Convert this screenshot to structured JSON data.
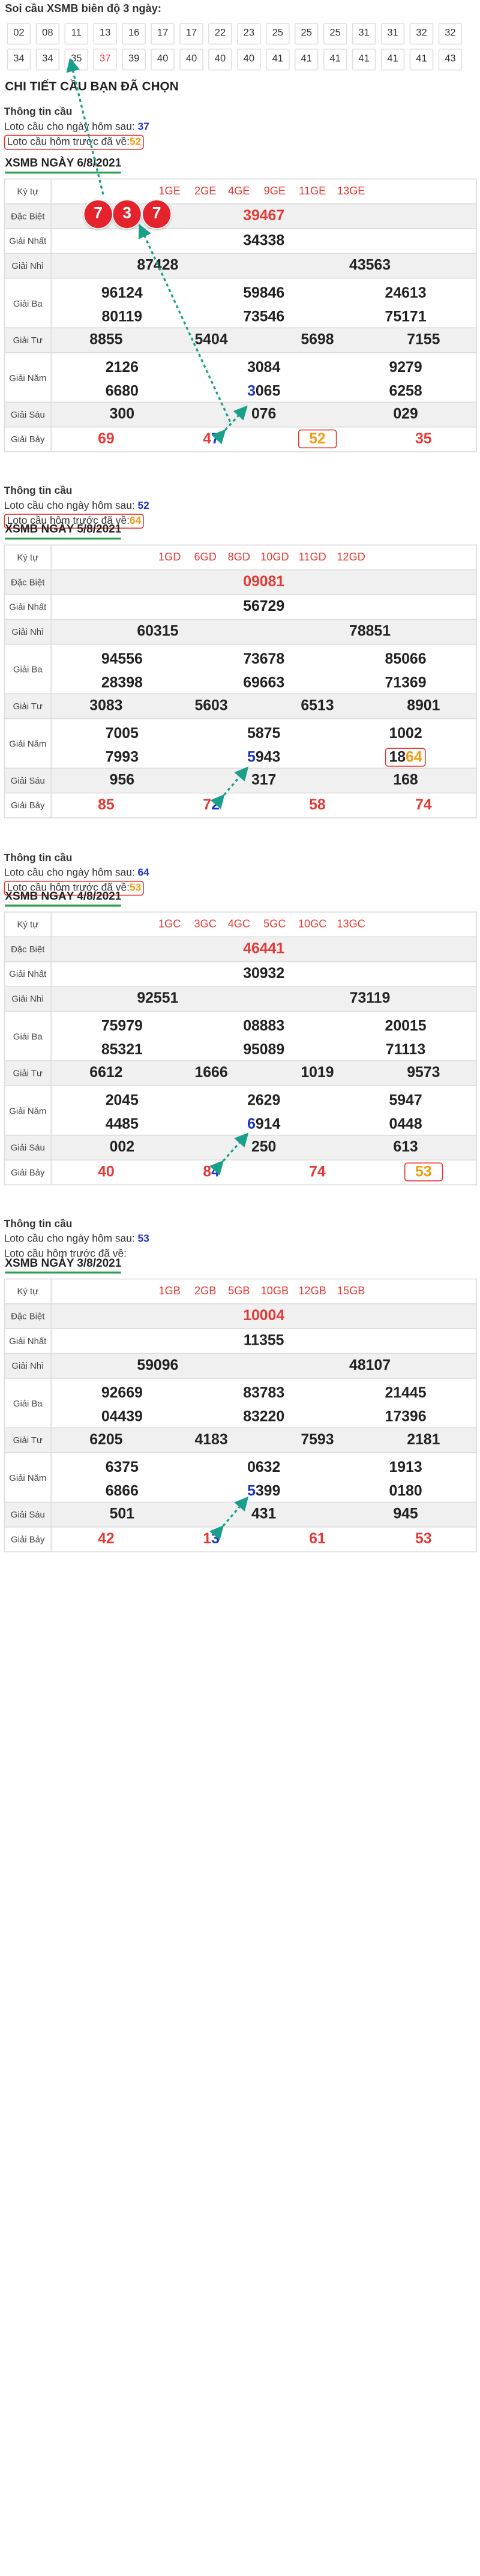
{
  "header": {
    "title": "Soi cầu XSMB biên độ 3 ngày:"
  },
  "chips": [
    "02",
    "08",
    "11",
    "13",
    "16",
    "17",
    "17",
    "22",
    "23",
    "25",
    "25",
    "25",
    "31",
    "31",
    "32",
    "32",
    "34",
    "34",
    "35",
    "37",
    "39",
    "40",
    "40",
    "40",
    "40",
    "41",
    "41",
    "41",
    "41",
    "41",
    "41",
    "43"
  ],
  "section_title": "CHI TIẾT CẦU BẠN ĐÃ CHỌN",
  "labels": {
    "info": "Thông tin cầu",
    "next": "Loto cầu cho ngày hôm sau:",
    "prev": "Loto cầu hôm trước đã về:",
    "ky_tu": "Ký tự",
    "dac_biet": "Đặc Biệt",
    "nhat": "Giải Nhất",
    "nhi": "Giải Nhì",
    "ba": "Giải Ba",
    "tu": "Giải Tư",
    "nam": "Giải Năm",
    "sau": "Giải Sáu",
    "bay": "Giải Bảy"
  },
  "days": [
    {
      "title": "XSMB NGÀY 6/8/2021",
      "next": "37",
      "prev": "52",
      "codes": [
        "1GE",
        "2GE",
        "4GE",
        "9GE",
        "11GE",
        "13GE"
      ],
      "db": "39467",
      "g1": "34338",
      "g2": [
        "87428",
        "43563"
      ],
      "g3": [
        "96124",
        "59846",
        "24613",
        "80119",
        "73546",
        "75171"
      ],
      "g4": [
        "8855",
        "5404",
        "5698",
        "7155"
      ],
      "g5": [
        "2126",
        "3084",
        "9279",
        "6680",
        "3065",
        "6258"
      ],
      "g6": [
        "300",
        "076",
        "029"
      ],
      "g7": [
        "69",
        "47",
        "52",
        "35"
      ]
    },
    {
      "title": "XSMB NGÀY 5/8/2021",
      "next": "52",
      "prev": "64",
      "codes": [
        "1GD",
        "6GD",
        "8GD",
        "10GD",
        "11GD",
        "12GD"
      ],
      "db": "09081",
      "g1": "56729",
      "g2": [
        "60315",
        "78851"
      ],
      "g3": [
        "94556",
        "73678",
        "85066",
        "28398",
        "69663",
        "71369"
      ],
      "g4": [
        "3083",
        "5603",
        "6513",
        "8901"
      ],
      "g5": [
        "7005",
        "5875",
        "1002",
        "7993",
        "5943",
        "1864"
      ],
      "g6": [
        "956",
        "317",
        "168"
      ],
      "g7": [
        "85",
        "72",
        "58",
        "74"
      ]
    },
    {
      "title": "XSMB NGÀY 4/8/2021",
      "next": "64",
      "prev": "53",
      "codes": [
        "1GC",
        "3GC",
        "4GC",
        "5GC",
        "10GC",
        "13GC"
      ],
      "db": "46441",
      "g1": "30932",
      "g2": [
        "92551",
        "73119"
      ],
      "g3": [
        "75979",
        "08883",
        "20015",
        "85321",
        "95089",
        "71113"
      ],
      "g4": [
        "6612",
        "1666",
        "1019",
        "9573"
      ],
      "g5": [
        "2045",
        "2629",
        "5947",
        "4485",
        "6914",
        "0448"
      ],
      "g6": [
        "002",
        "250",
        "613"
      ],
      "g7": [
        "40",
        "84",
        "74",
        "53"
      ]
    },
    {
      "title": "XSMB NGÀY 3/8/2021",
      "next": "53",
      "prev": "",
      "codes": [
        "1GB",
        "2GB",
        "5GB",
        "10GB",
        "12GB",
        "15GB"
      ],
      "db": "10004",
      "g1": "11355",
      "g2": [
        "59096",
        "48107"
      ],
      "g3": [
        "92669",
        "83783",
        "21445",
        "04439",
        "83220",
        "17396"
      ],
      "g4": [
        "6205",
        "4183",
        "7593",
        "2181"
      ],
      "g5": [
        "6375",
        "0632",
        "1913",
        "6866",
        "5399",
        "0180"
      ],
      "g6": [
        "501",
        "431",
        "945"
      ],
      "g7": [
        "42",
        "13",
        "61",
        "53"
      ]
    }
  ],
  "balls": [
    "7",
    "3",
    "7"
  ],
  "colors": {
    "accent_red": "#e53935",
    "blue": "#1a33c8",
    "orange": "#f39c12",
    "green_line": "#2e9e4f",
    "arrow": "#1aa08a"
  }
}
